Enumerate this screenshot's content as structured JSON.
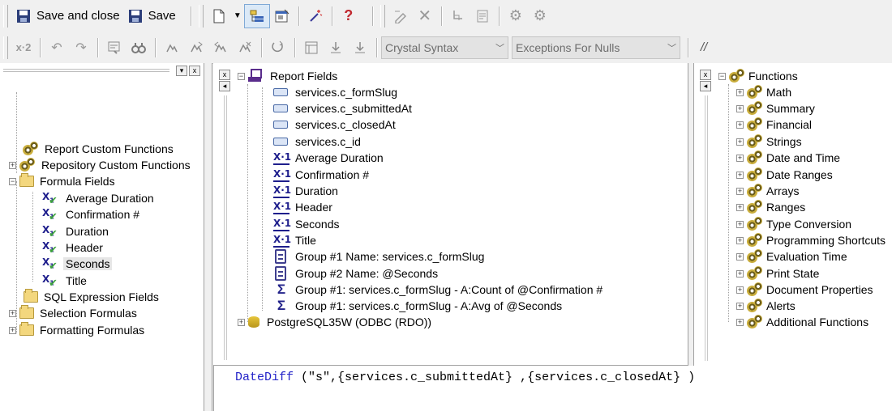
{
  "toolbar1": {
    "save_close_label": "Save and close",
    "save_label": "Save"
  },
  "toolbar2": {
    "syntax_combo": "Crystal Syntax",
    "nulls_combo": "Exceptions For Nulls",
    "comment_label": "//"
  },
  "left_tree": {
    "items": [
      {
        "label": "Report Custom Functions"
      },
      {
        "label": "Repository Custom Functions"
      },
      {
        "label": "Formula Fields"
      },
      {
        "label": "Average Duration"
      },
      {
        "label": "Confirmation #"
      },
      {
        "label": "Duration"
      },
      {
        "label": "Header"
      },
      {
        "label": "Seconds"
      },
      {
        "label": "Title"
      },
      {
        "label": "SQL Expression Fields"
      },
      {
        "label": "Selection Formulas"
      },
      {
        "label": "Formatting Formulas"
      }
    ]
  },
  "middle_tree": {
    "root": "Report Fields",
    "items": [
      {
        "label": "services.c_formSlug"
      },
      {
        "label": "services.c_submittedAt"
      },
      {
        "label": "services.c_closedAt"
      },
      {
        "label": "services.c_id"
      },
      {
        "label": "Average Duration"
      },
      {
        "label": "Confirmation #"
      },
      {
        "label": "Duration"
      },
      {
        "label": "Header"
      },
      {
        "label": "Seconds"
      },
      {
        "label": "Title"
      },
      {
        "label": "Group #1 Name: services.c_formSlug"
      },
      {
        "label": "Group #2 Name: @Seconds"
      },
      {
        "label": "Group #1: services.c_formSlug - A:Count of @Confirmation #"
      },
      {
        "label": "Group #1: services.c_formSlug - A:Avg of @Seconds"
      }
    ],
    "datasource": "PostgreSQL35W (ODBC (RDO))"
  },
  "right_tree": {
    "root": "Functions",
    "items": [
      {
        "label": "Math"
      },
      {
        "label": "Summary"
      },
      {
        "label": "Financial"
      },
      {
        "label": "Strings"
      },
      {
        "label": "Date and Time"
      },
      {
        "label": "Date Ranges"
      },
      {
        "label": "Arrays"
      },
      {
        "label": "Ranges"
      },
      {
        "label": "Type Conversion"
      },
      {
        "label": "Programming Shortcuts"
      },
      {
        "label": "Evaluation Time"
      },
      {
        "label": "Print State"
      },
      {
        "label": "Document Properties"
      },
      {
        "label": "Alerts"
      },
      {
        "label": "Additional Functions"
      }
    ]
  },
  "editor": {
    "keyword": "DateDiff",
    "args": " (\"s\",{services.c_submittedAt} ,{services.c_closedAt} )"
  },
  "pane_buttons": {
    "close": "x",
    "scroll_left": "◂",
    "dropdown": "▾"
  },
  "colors": {
    "keyword": "#2323c8",
    "selection_bg": "#e6e6e6",
    "pressed_bg": "#dbe9f7"
  }
}
